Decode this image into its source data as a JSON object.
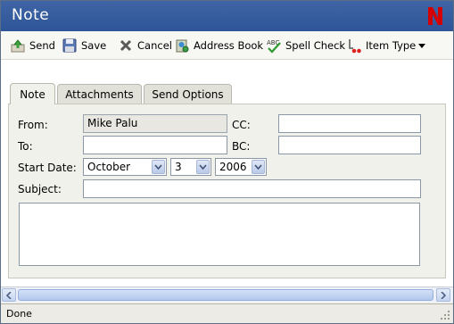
{
  "window": {
    "title": "Note"
  },
  "toolbar": {
    "send": "Send",
    "save": "Save",
    "cancel": "Cancel",
    "address_book": "Address Book",
    "spell_check": "Spell Check",
    "item_type": "Item Type"
  },
  "tabs": [
    {
      "label": "Note",
      "active": true
    },
    {
      "label": "Attachments",
      "active": false
    },
    {
      "label": "Send Options",
      "active": false
    }
  ],
  "form": {
    "from_label": "From:",
    "from_value": "Mike Palu",
    "cc_label": "CC:",
    "cc_value": "",
    "to_label": "To:",
    "to_value": "",
    "bc_label": "BC:",
    "bc_value": "",
    "start_date_label": "Start Date:",
    "month": "October",
    "day": "3",
    "year": "2006",
    "subject_label": "Subject:",
    "subject_value": "",
    "body": ""
  },
  "status": {
    "text": "Done"
  },
  "colors": {
    "title_bar": "#2e5598",
    "brand": "#d40000"
  }
}
